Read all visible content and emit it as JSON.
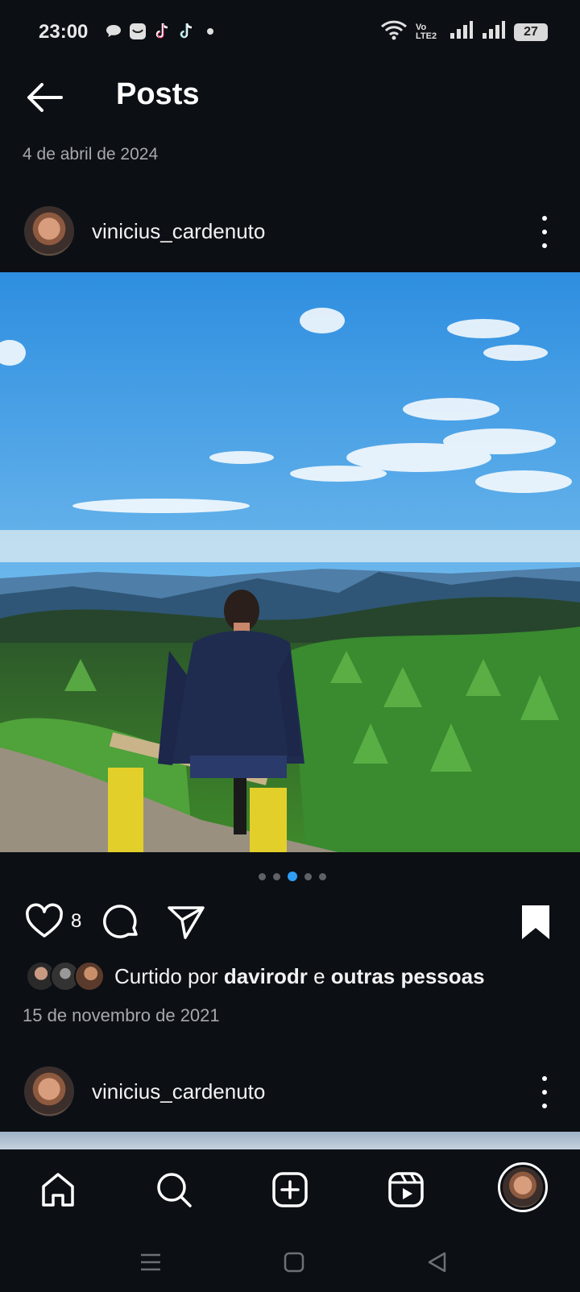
{
  "status_bar": {
    "time": "23:00",
    "notification_icons": [
      "chat-bubble-icon",
      "mail-app-icon",
      "tiktok-icon",
      "tiktok-icon",
      "dot-icon"
    ],
    "network_label": "Vo LTE2",
    "battery": "27"
  },
  "header": {
    "title": "Posts",
    "date": "4 de abril de 2024"
  },
  "posts": [
    {
      "username": "vinicius_cardenuto",
      "image_description_icon": "photo",
      "carousel": {
        "count": 5,
        "active_index": 2
      },
      "likes": "8",
      "liked_by_prefix": "Curtido por ",
      "liked_by_user": "davirodr",
      "liked_by_conjunction": " e ",
      "liked_by_suffix": "outras pessoas",
      "date": "15 de novembro de 2021",
      "saved": true
    },
    {
      "username": "vinicius_cardenuto"
    }
  ],
  "bottom_nav": {
    "items": [
      "home-icon",
      "search-icon",
      "create-icon",
      "reels-icon",
      "profile-avatar"
    ]
  },
  "colors": {
    "background": "#0c0f14",
    "accent_dot": "#2f9df5",
    "secondary_text": "#a6a8ad"
  }
}
